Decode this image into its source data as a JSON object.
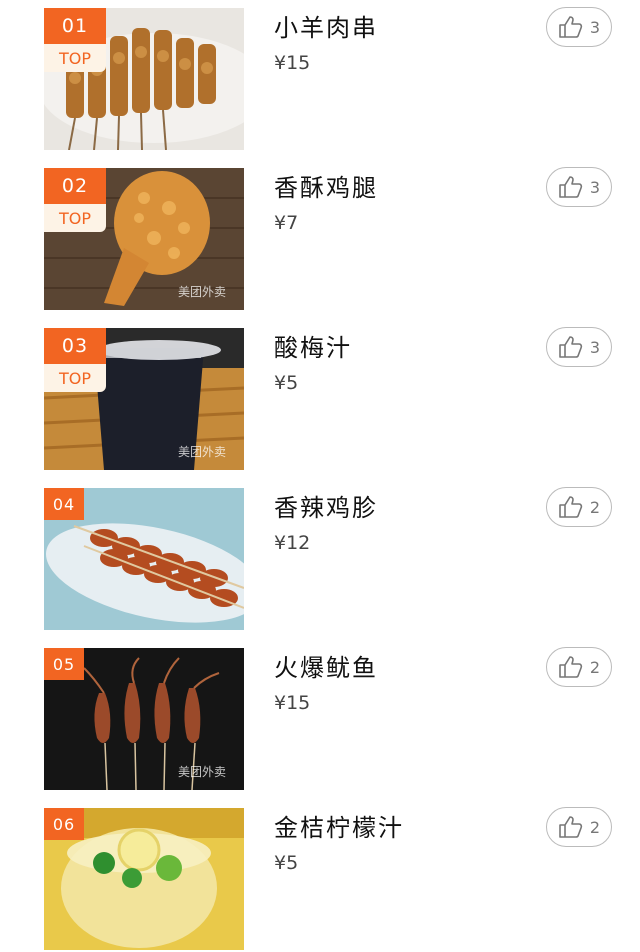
{
  "watermark_text": "美团外卖",
  "top_tag_label": "TOP",
  "items": [
    {
      "rank": "01",
      "name": "小羊肉串",
      "price": "¥15",
      "likes": "3",
      "is_top": true,
      "thumb_icon": "lamb-skewer-image"
    },
    {
      "rank": "02",
      "name": "香酥鸡腿",
      "price": "¥7",
      "likes": "3",
      "is_top": true,
      "thumb_icon": "fried-chicken-leg-image"
    },
    {
      "rank": "03",
      "name": "酸梅汁",
      "price": "¥5",
      "likes": "3",
      "is_top": true,
      "thumb_icon": "plum-juice-image"
    },
    {
      "rank": "04",
      "name": "香辣鸡胗",
      "price": "¥12",
      "likes": "2",
      "is_top": false,
      "thumb_icon": "spicy-gizzard-image"
    },
    {
      "rank": "05",
      "name": "火爆鱿鱼",
      "price": "¥15",
      "likes": "2",
      "is_top": false,
      "thumb_icon": "squid-skewer-image"
    },
    {
      "rank": "06",
      "name": "金桔柠檬汁",
      "price": "¥5",
      "likes": "2",
      "is_top": false,
      "thumb_icon": "kumquat-lemon-juice-image"
    }
  ]
}
